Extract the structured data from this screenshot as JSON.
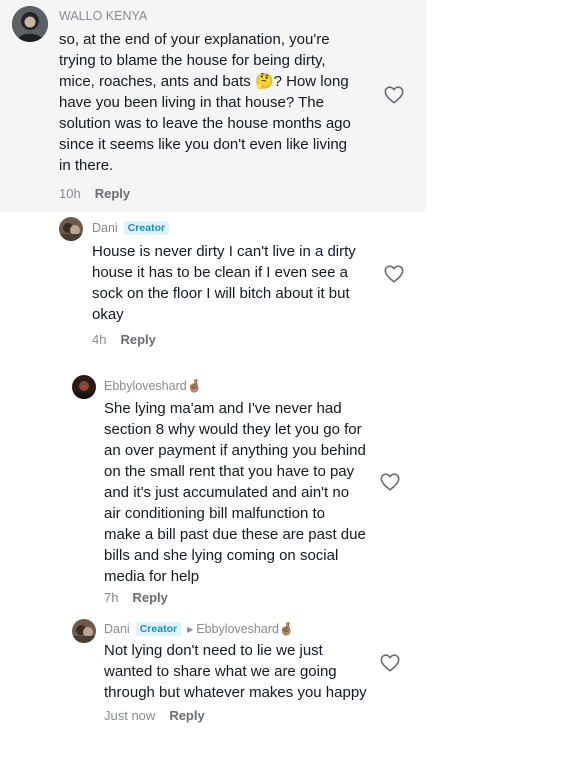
{
  "colors": {
    "highlight_bg": "#f5f5f5",
    "creator_badge_bg": "#dff3fb",
    "creator_badge_text": "#1f8ec4"
  },
  "comments": [
    {
      "username": "WALLO KENYA",
      "lines": [
        "so, at the end of your explanation, you're",
        "trying to blame the house for being dirty,",
        "mice, roaches, ants and bats 🤔? How long",
        "have you been living in that house? The",
        "solution was to leave the house months ago",
        "since it seems like you don't even like living",
        "in there."
      ],
      "time": "10h",
      "reply_label": "Reply",
      "like_icon": "heart-outline-icon"
    },
    {
      "username": "Dani",
      "badge": "Creator",
      "lines": [
        "House is never dirty I can't live in a dirty",
        "house it has to be clean if I even see a",
        "sock on the floor I will bitch about it but",
        "okay"
      ],
      "time": "4h",
      "reply_label": "Reply",
      "like_icon": "heart-outline-icon"
    },
    {
      "username": "Ebbyloveshard🤞🏽",
      "lines": [
        "She lying ma'am and I've never had",
        "section 8 why would they let you go for",
        "an over payment if anything you behind",
        "on the small rent that you have to pay",
        "and it's just accumulated and ain't no",
        "air conditioning bill malfunction to",
        "make a bill past due these are past due",
        "bills and she lying coming on social",
        "media for help"
      ],
      "time": "7h",
      "reply_label": "Reply",
      "like_icon": "heart-outline-icon"
    },
    {
      "username": "Dani",
      "badge": "Creator",
      "reply_to": "Ebbyloveshard🤞🏽",
      "lines": [
        "Not lying don't need to lie we just",
        "wanted to share what we are going",
        "through but whatever makes you happy"
      ],
      "time": "Just now",
      "reply_label": "Reply",
      "like_icon": "heart-outline-icon"
    }
  ]
}
